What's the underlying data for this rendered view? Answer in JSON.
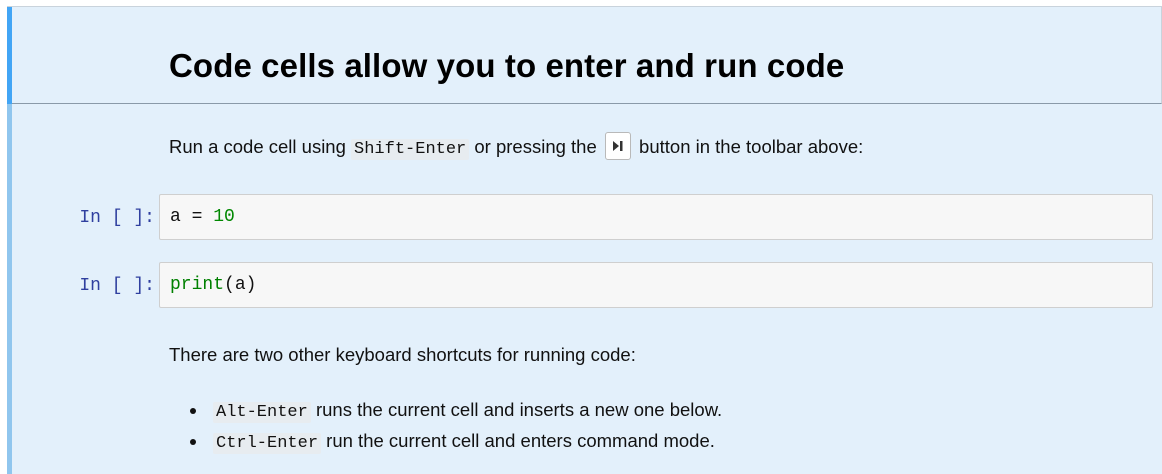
{
  "heading": {
    "title": "Code cells allow you to enter and run code"
  },
  "intro": {
    "before": "Run a code cell using ",
    "shortcut": "Shift-Enter",
    "middle": " or pressing the ",
    "button_icon": "run-cell-icon",
    "after": " button in the toolbar above:"
  },
  "cells": [
    {
      "prompt": "In [ ]:",
      "code_var": "a = ",
      "code_num": "10"
    },
    {
      "prompt": "In [ ]:",
      "code_builtin": "print",
      "code_rest": "(a)"
    }
  ],
  "other": {
    "intro": "There are two other keyboard shortcuts for running code:",
    "items": [
      {
        "shortcut": "Alt-Enter",
        "text": " runs the current cell and inserts a new one below."
      },
      {
        "shortcut": "Ctrl-Enter",
        "text": " run the current cell and enters command mode."
      }
    ]
  },
  "colors": {
    "cell_background": "#e3f0fb",
    "selected_bar": "#42a5f5",
    "prompt": "#2f3f9f",
    "number": "#008800"
  }
}
